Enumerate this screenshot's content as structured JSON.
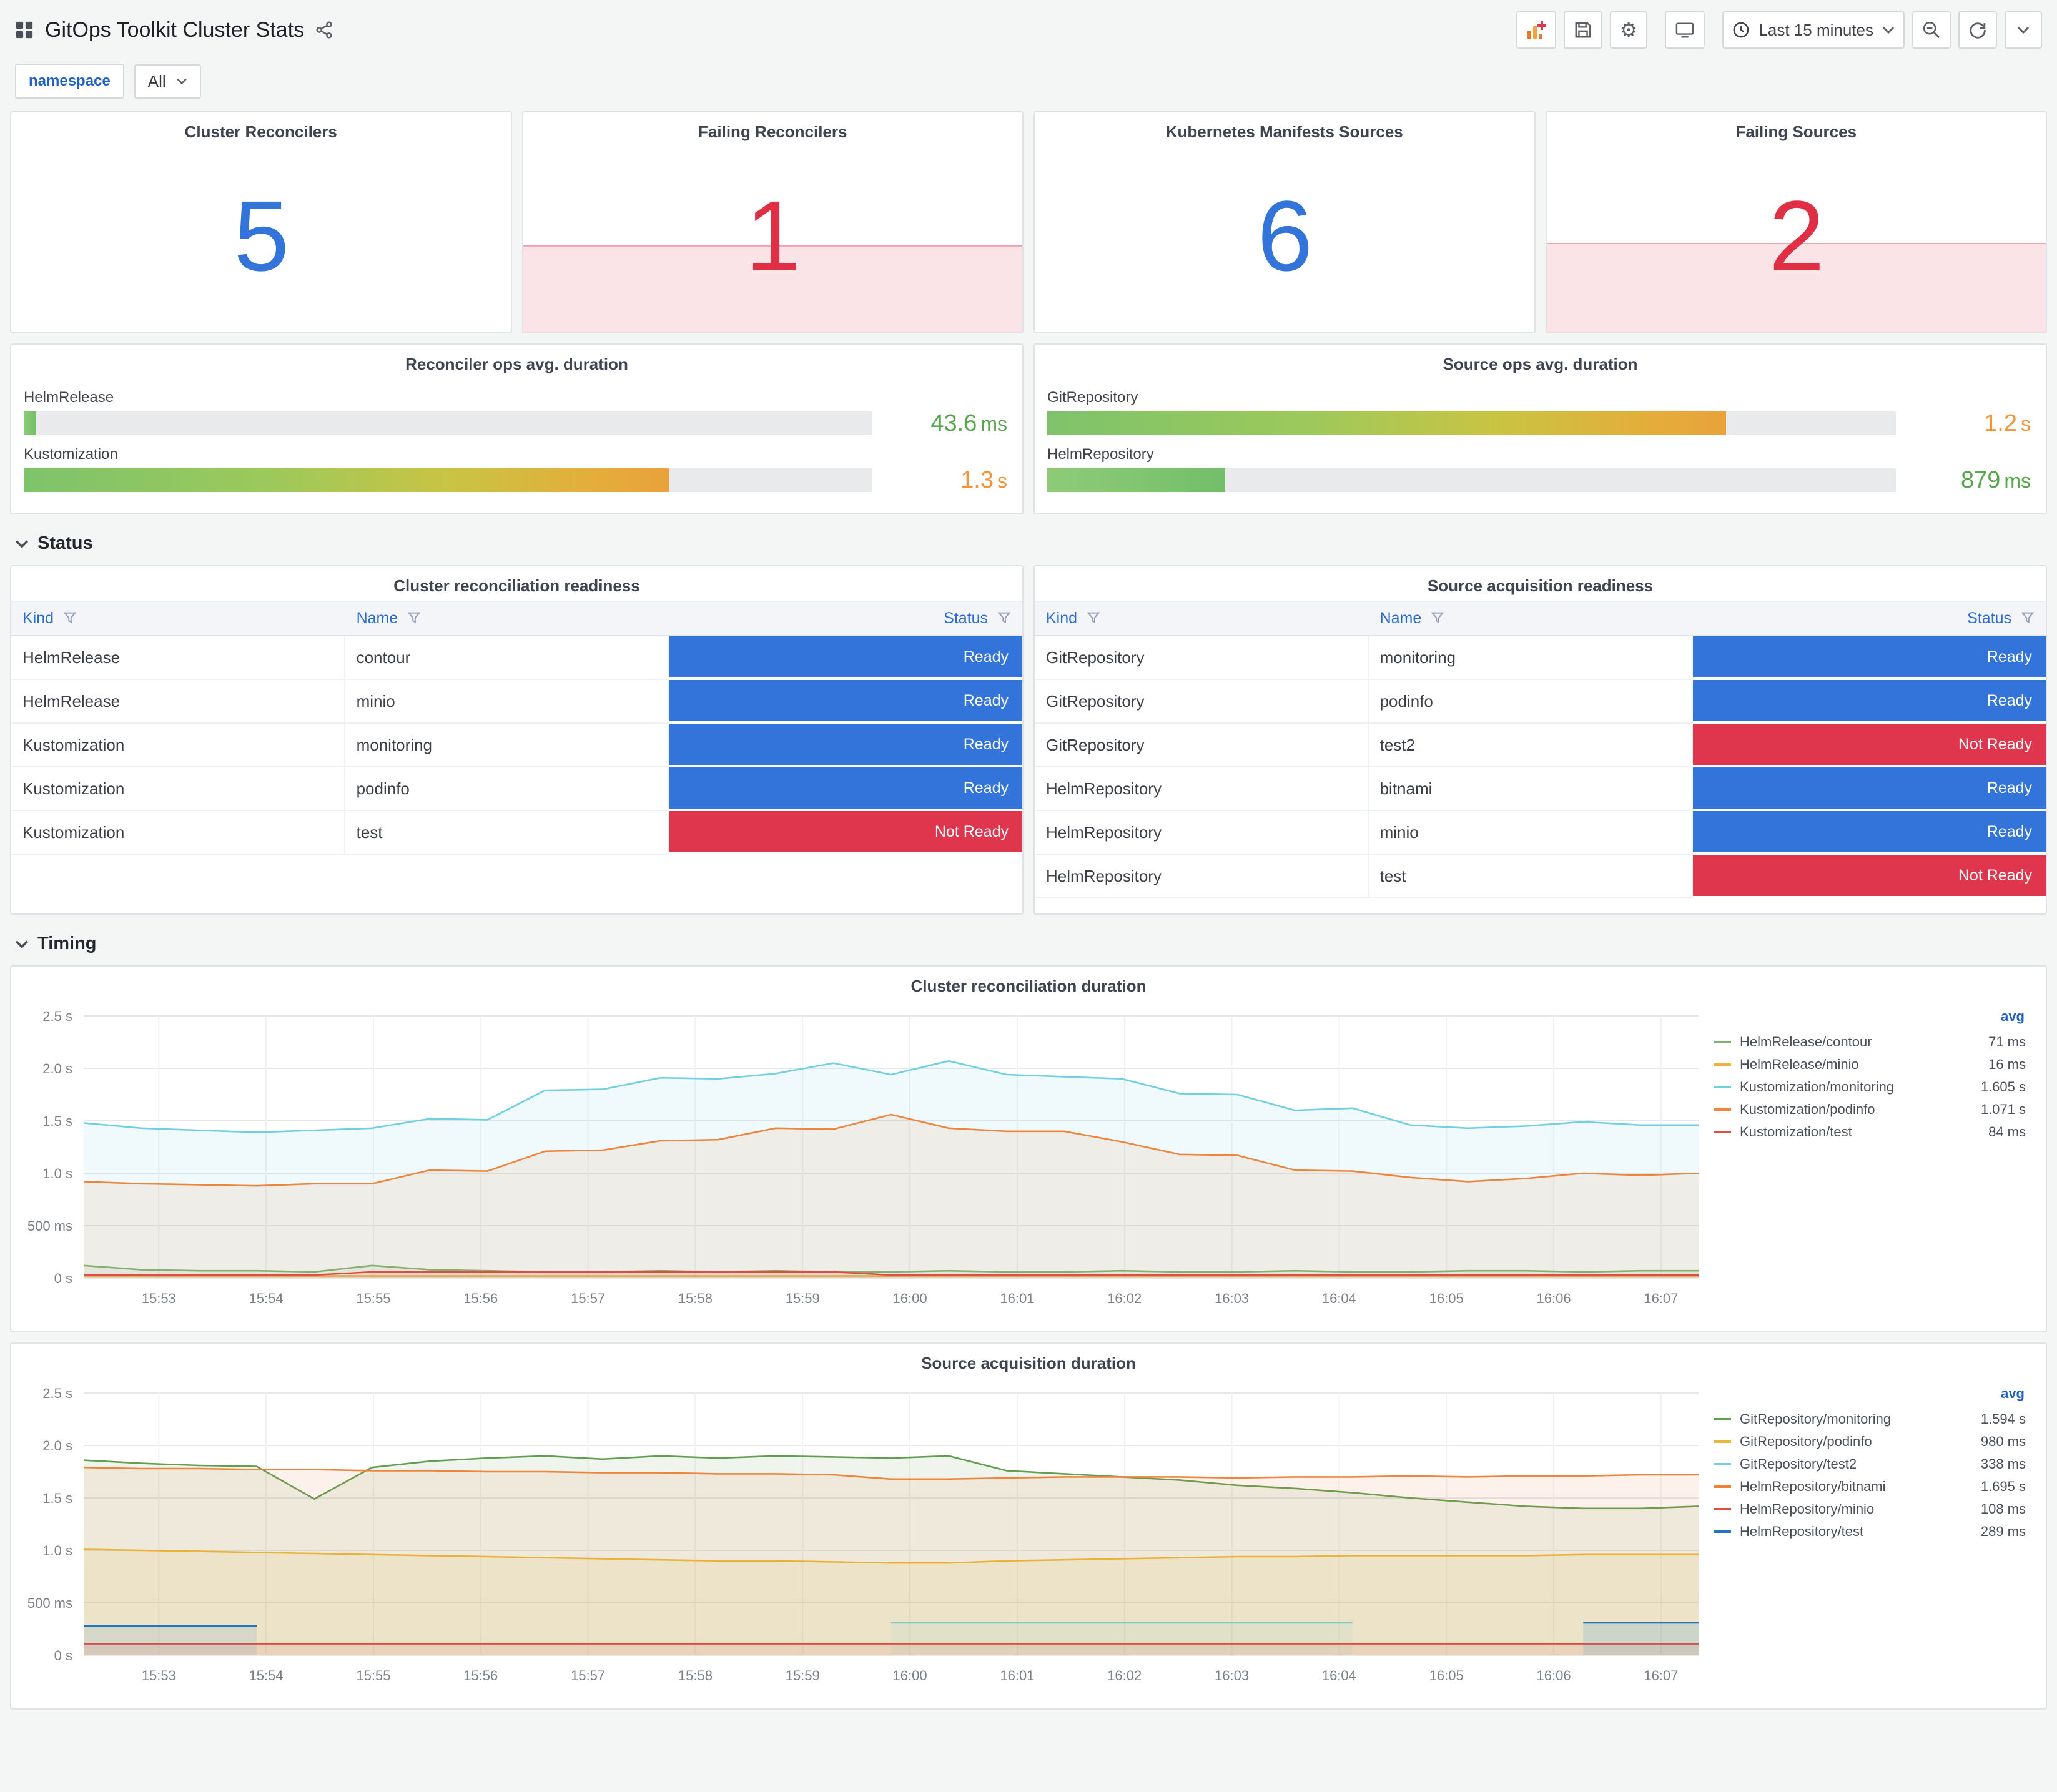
{
  "header": {
    "title": "GitOps Toolkit Cluster Stats",
    "time_range_label": "Last 15 minutes"
  },
  "filters": {
    "name_label": "namespace",
    "value": "All"
  },
  "sections": {
    "status": "Status",
    "timing": "Timing"
  },
  "colors": {
    "stat_blue": "#3274d9",
    "stat_red": "#e02f44",
    "ready_blue": "#3274d9",
    "not_ready_red": "#e0364d",
    "value_green": "#56a64b",
    "value_orange": "#f59338"
  },
  "stats": [
    {
      "title": "Cluster Reconcilers",
      "value": "5",
      "color": "#3274d9",
      "fill_pct": 0
    },
    {
      "title": "Failing Reconcilers",
      "value": "1",
      "color": "#e02f44",
      "fill_pct": 39
    },
    {
      "title": "Kubernetes Manifests Sources",
      "value": "6",
      "color": "#3274d9",
      "fill_pct": 0
    },
    {
      "title": "Failing Sources",
      "value": "2",
      "color": "#e02f44",
      "fill_pct": 40
    }
  ],
  "gauges": [
    {
      "title": "Reconciler ops avg. duration",
      "rows": [
        {
          "label": "HelmRelease",
          "pct": 1.5,
          "value": "43.6",
          "unit": "ms",
          "value_color": "#56a64b",
          "bar": "green"
        },
        {
          "label": "Kustomization",
          "pct": 76,
          "value": "1.3",
          "unit": "s",
          "value_color": "#f59338",
          "bar": "gradient"
        }
      ]
    },
    {
      "title": "Source ops avg. duration",
      "rows": [
        {
          "label": "GitRepository",
          "pct": 80,
          "value": "1.2",
          "unit": "s",
          "value_color": "#f59338",
          "bar": "gradient"
        },
        {
          "label": "HelmRepository",
          "pct": 21,
          "value": "879",
          "unit": "ms",
          "value_color": "#56a64b",
          "bar": "green"
        }
      ]
    }
  ],
  "tables": [
    {
      "title": "Cluster reconciliation readiness",
      "columns": [
        "Kind",
        "Name",
        "Status"
      ],
      "rows": [
        {
          "kind": "HelmRelease",
          "name": "contour",
          "status": "Ready"
        },
        {
          "kind": "HelmRelease",
          "name": "minio",
          "status": "Ready"
        },
        {
          "kind": "Kustomization",
          "name": "monitoring",
          "status": "Ready"
        },
        {
          "kind": "Kustomization",
          "name": "podinfo",
          "status": "Ready"
        },
        {
          "kind": "Kustomization",
          "name": "test",
          "status": "Not Ready"
        }
      ]
    },
    {
      "title": "Source acquisition readiness",
      "columns": [
        "Kind",
        "Name",
        "Status"
      ],
      "rows": [
        {
          "kind": "GitRepository",
          "name": "monitoring",
          "status": "Ready"
        },
        {
          "kind": "GitRepository",
          "name": "podinfo",
          "status": "Ready"
        },
        {
          "kind": "GitRepository",
          "name": "test2",
          "status": "Not Ready"
        },
        {
          "kind": "HelmRepository",
          "name": "bitnami",
          "status": "Ready"
        },
        {
          "kind": "HelmRepository",
          "name": "minio",
          "status": "Ready"
        },
        {
          "kind": "HelmRepository",
          "name": "test",
          "status": "Not Ready"
        }
      ]
    }
  ],
  "chart_data": [
    {
      "type": "line",
      "title": "Cluster reconciliation duration",
      "x_ticks": [
        "15:53",
        "15:54",
        "15:55",
        "15:56",
        "15:57",
        "15:58",
        "15:59",
        "16:00",
        "16:01",
        "16:02",
        "16:03",
        "16:04",
        "16:05",
        "16:06",
        "16:07"
      ],
      "y_ticks": [
        {
          "label": "0 s",
          "value": 0
        },
        {
          "label": "500 ms",
          "value": 0.5
        },
        {
          "label": "1.0 s",
          "value": 1
        },
        {
          "label": "1.5 s",
          "value": 1.5
        },
        {
          "label": "2.0 s",
          "value": 2
        },
        {
          "label": "2.5 s",
          "value": 2.5
        }
      ],
      "ylim": [
        0,
        2.5
      ],
      "grid": true,
      "legend_position": "right",
      "legend_header": "avg",
      "series": [
        {
          "name": "HelmRelease/contour",
          "avg": "71 ms",
          "color": "#7EB26D",
          "values": [
            0.12,
            0.08,
            0.07,
            0.07,
            0.06,
            0.12,
            0.08,
            0.07,
            0.06,
            0.06,
            0.07,
            0.06,
            0.07,
            0.06,
            0.06,
            0.07,
            0.06,
            0.06,
            0.07,
            0.06,
            0.06,
            0.07,
            0.06,
            0.06,
            0.07,
            0.07,
            0.06,
            0.07,
            0.07
          ]
        },
        {
          "name": "HelmRelease/minio",
          "avg": "16 ms",
          "color": "#EAB839",
          "values": [
            0.02,
            0.02,
            0.02,
            0.02,
            0.02,
            0.02,
            0.02,
            0.02,
            0.02,
            0.02,
            0.02,
            0.02,
            0.02,
            0.02,
            0.02,
            0.02,
            0.02,
            0.02,
            0.02,
            0.02,
            0.02,
            0.02,
            0.02,
            0.02,
            0.02,
            0.02,
            0.02,
            0.02,
            0.02
          ]
        },
        {
          "name": "Kustomization/monitoring",
          "avg": "1.605 s",
          "color": "#6ED0E0",
          "values": [
            1.48,
            1.43,
            1.41,
            1.39,
            1.41,
            1.43,
            1.52,
            1.51,
            1.79,
            1.8,
            1.91,
            1.9,
            1.95,
            2.05,
            1.94,
            2.07,
            1.94,
            1.92,
            1.9,
            1.76,
            1.75,
            1.6,
            1.62,
            1.46,
            1.43,
            1.45,
            1.49,
            1.46,
            1.46
          ]
        },
        {
          "name": "Kustomization/podinfo",
          "avg": "1.071 s",
          "color": "#EF843C",
          "values": [
            0.92,
            0.9,
            0.89,
            0.88,
            0.9,
            0.9,
            1.03,
            1.02,
            1.21,
            1.22,
            1.31,
            1.32,
            1.43,
            1.42,
            1.56,
            1.43,
            1.4,
            1.4,
            1.3,
            1.18,
            1.17,
            1.03,
            1.02,
            0.96,
            0.92,
            0.95,
            1.0,
            0.98,
            1.0
          ]
        },
        {
          "name": "Kustomization/test",
          "avg": "84 ms",
          "color": "#E24D42",
          "values": [
            0.03,
            0.03,
            0.03,
            0.03,
            0.03,
            0.06,
            0.06,
            0.06,
            0.06,
            0.06,
            0.06,
            0.06,
            0.06,
            0.06,
            0.03,
            0.03,
            0.03,
            0.03,
            0.03,
            0.03,
            0.03,
            0.03,
            0.03,
            0.03,
            0.03,
            0.03,
            0.03,
            0.03,
            0.03
          ]
        }
      ]
    },
    {
      "type": "line",
      "title": "Source acquisition duration",
      "x_ticks": [
        "15:53",
        "15:54",
        "15:55",
        "15:56",
        "15:57",
        "15:58",
        "15:59",
        "16:00",
        "16:01",
        "16:02",
        "16:03",
        "16:04",
        "16:05",
        "16:06",
        "16:07"
      ],
      "y_ticks": [
        {
          "label": "0 s",
          "value": 0
        },
        {
          "label": "500 ms",
          "value": 0.5
        },
        {
          "label": "1.0 s",
          "value": 1
        },
        {
          "label": "1.5 s",
          "value": 1.5
        },
        {
          "label": "2.0 s",
          "value": 2
        },
        {
          "label": "2.5 s",
          "value": 2.5
        }
      ],
      "ylim": [
        0,
        2.5
      ],
      "grid": true,
      "legend_position": "right",
      "legend_header": "avg",
      "series": [
        {
          "name": "GitRepository/monitoring",
          "avg": "1.594 s",
          "color": "#629E51",
          "values": [
            1.86,
            1.83,
            1.81,
            1.8,
            1.49,
            1.79,
            1.85,
            1.88,
            1.9,
            1.87,
            1.9,
            1.88,
            1.9,
            1.89,
            1.88,
            1.9,
            1.76,
            1.73,
            1.7,
            1.67,
            1.62,
            1.59,
            1.55,
            1.5,
            1.46,
            1.42,
            1.4,
            1.4,
            1.42
          ]
        },
        {
          "name": "GitRepository/podinfo",
          "avg": "980 ms",
          "color": "#EAB839",
          "values": [
            1.01,
            1.0,
            0.99,
            0.98,
            0.97,
            0.96,
            0.95,
            0.94,
            0.93,
            0.92,
            0.91,
            0.9,
            0.9,
            0.89,
            0.88,
            0.88,
            0.9,
            0.91,
            0.92,
            0.93,
            0.94,
            0.94,
            0.95,
            0.95,
            0.95,
            0.95,
            0.96,
            0.96,
            0.96
          ]
        },
        {
          "name": "GitRepository/test2",
          "avg": "338 ms",
          "color": "#6ED0E0",
          "values": [
            null,
            null,
            null,
            null,
            null,
            null,
            null,
            null,
            null,
            null,
            null,
            null,
            null,
            null,
            0.31,
            0.31,
            0.31,
            0.31,
            0.31,
            0.31,
            0.31,
            0.31,
            0.31,
            null,
            null,
            null,
            0.31,
            0.31,
            0.31
          ]
        },
        {
          "name": "HelmRepository/bitnami",
          "avg": "1.695 s",
          "color": "#EF843C",
          "values": [
            1.79,
            1.78,
            1.78,
            1.77,
            1.77,
            1.76,
            1.76,
            1.75,
            1.75,
            1.74,
            1.74,
            1.73,
            1.73,
            1.72,
            1.68,
            1.68,
            1.69,
            1.7,
            1.7,
            1.7,
            1.69,
            1.7,
            1.7,
            1.71,
            1.7,
            1.71,
            1.71,
            1.72,
            1.72
          ]
        },
        {
          "name": "HelmRepository/minio",
          "avg": "108 ms",
          "color": "#E24D42",
          "values": [
            0.11,
            0.11,
            0.11,
            0.11,
            0.11,
            0.11,
            0.11,
            0.11,
            0.11,
            0.11,
            0.11,
            0.11,
            0.11,
            0.11,
            0.11,
            0.11,
            0.11,
            0.11,
            0.11,
            0.11,
            0.11,
            0.11,
            0.11,
            0.11,
            0.11,
            0.11,
            0.11,
            0.11,
            0.11
          ]
        },
        {
          "name": "HelmRepository/test",
          "avg": "289 ms",
          "color": "#1F78C1",
          "values": [
            0.28,
            0.28,
            0.28,
            0.28,
            null,
            null,
            null,
            null,
            null,
            null,
            null,
            null,
            null,
            null,
            null,
            null,
            null,
            null,
            null,
            null,
            null,
            null,
            null,
            null,
            null,
            null,
            0.31,
            0.31,
            0.31
          ]
        }
      ]
    }
  ]
}
